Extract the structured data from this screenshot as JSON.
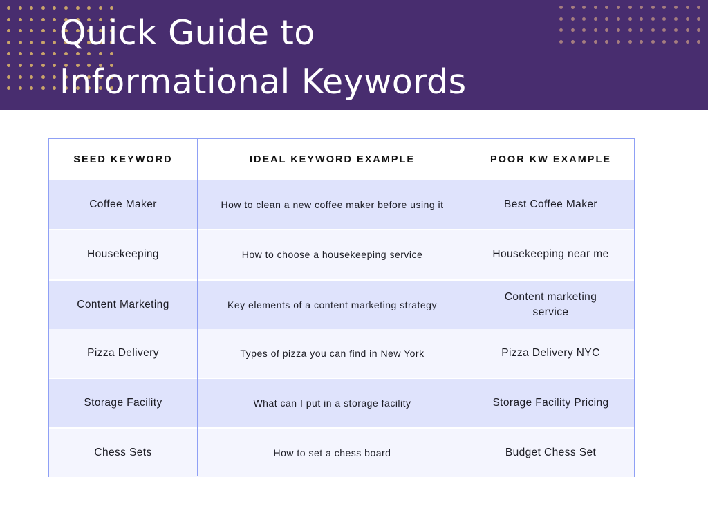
{
  "banner": {
    "title_line1": "Quick Guide to",
    "title_line2": "Informational Keywords",
    "background_color": "#482d6f",
    "dot_color_left": "#c9a46a",
    "dot_color_right": "#a57d7f"
  },
  "table": {
    "headers": [
      "SEED KEYWORD",
      "IDEAL KEYWORD EXAMPLE",
      "POOR KW EXAMPLE"
    ],
    "rows": [
      {
        "seed": "Coffee Maker",
        "ideal": "How to clean a new coffee maker before using it",
        "poor": "Best Coffee Maker"
      },
      {
        "seed": "Housekeeping",
        "ideal": "How to choose a housekeeping service",
        "poor": "Housekeeping near me"
      },
      {
        "seed": "Content Marketing",
        "ideal": "Key elements of a content marketing strategy",
        "poor": "Content marketing service"
      },
      {
        "seed": "Pizza Delivery",
        "ideal": "Types of pizza you can find in New York",
        "poor": "Pizza Delivery NYC"
      },
      {
        "seed": "Storage Facility",
        "ideal": "What can I put in a storage facility",
        "poor": "Storage Facility Pricing"
      },
      {
        "seed": "Chess Sets",
        "ideal": "How to set a chess board",
        "poor": "Budget Chess Set"
      }
    ],
    "border_color": "#8fa0f5",
    "row_shaded_color": "#dfe3fc",
    "row_light_color": "#f4f5fe"
  }
}
